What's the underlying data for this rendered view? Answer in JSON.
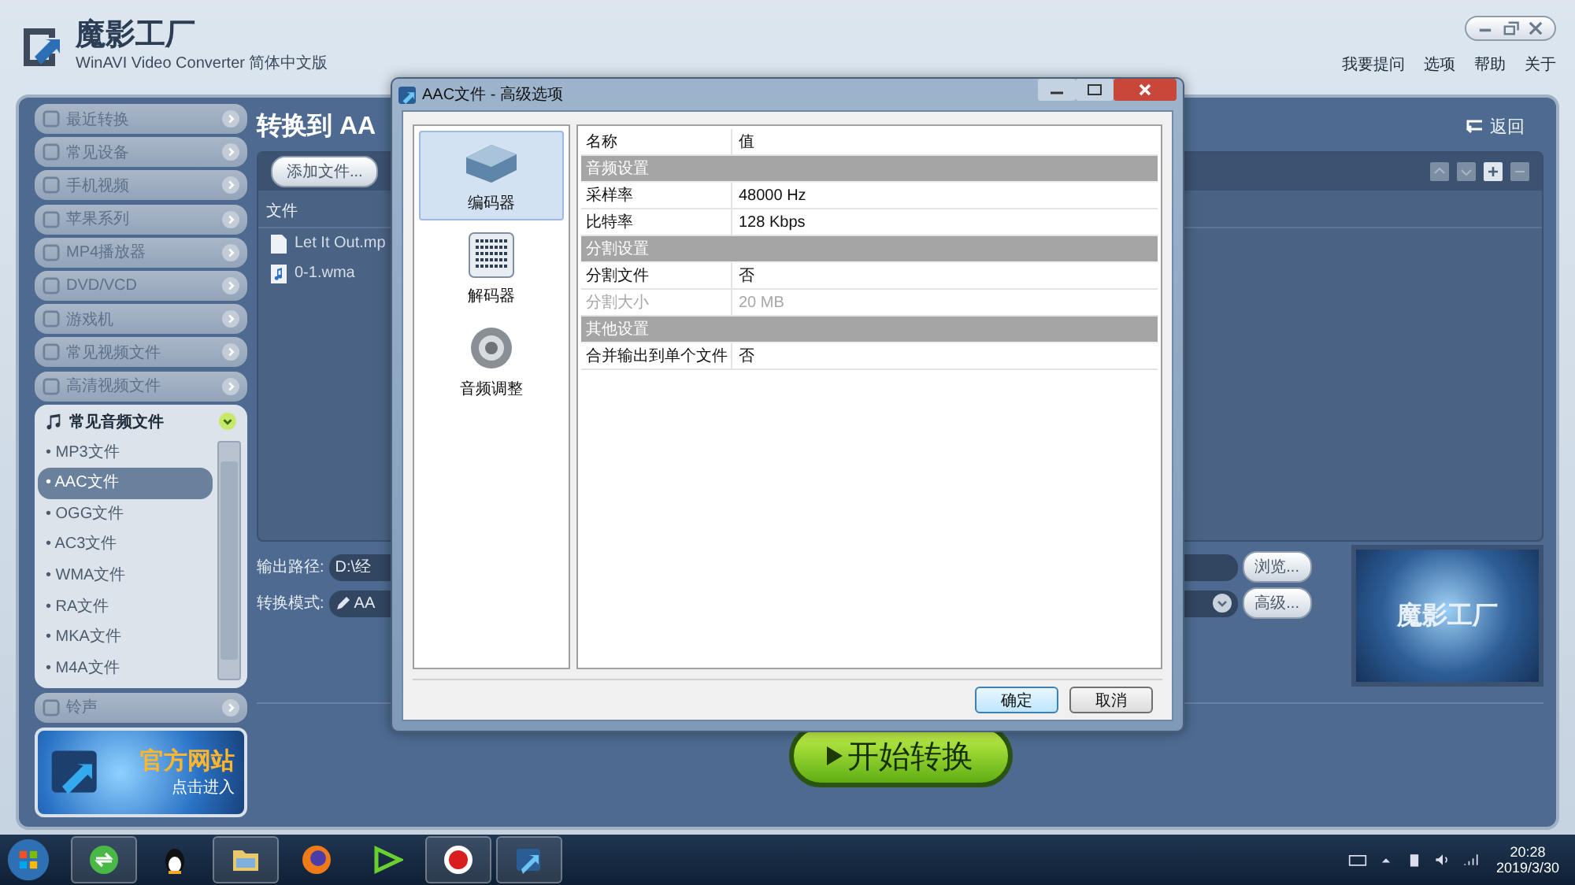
{
  "app": {
    "title": "魔影工厂",
    "subtitle": "WinAVI Video Converter 简体中文版",
    "menu": [
      "我要提问",
      "选项",
      "帮助",
      "关于"
    ]
  },
  "sidebar": {
    "categories": [
      {
        "label": "最近转换",
        "expanded": false
      },
      {
        "label": "常见设备",
        "expanded": false
      },
      {
        "label": "手机视频",
        "expanded": false
      },
      {
        "label": "苹果系列",
        "expanded": false
      },
      {
        "label": "MP4播放器",
        "expanded": false
      },
      {
        "label": "DVD/VCD",
        "expanded": false
      },
      {
        "label": "游戏机",
        "expanded": false
      },
      {
        "label": "常见视频文件",
        "expanded": false
      },
      {
        "label": "高清视频文件",
        "expanded": false
      },
      {
        "label": "常见音频文件",
        "expanded": true,
        "children": [
          {
            "label": "• MP3文件",
            "selected": false
          },
          {
            "label": "• AAC文件",
            "selected": true
          },
          {
            "label": "• OGG文件",
            "selected": false
          },
          {
            "label": "• AC3文件",
            "selected": false
          },
          {
            "label": "• WMA文件",
            "selected": false
          },
          {
            "label": "• RA文件",
            "selected": false
          },
          {
            "label": "• MKA文件",
            "selected": false
          },
          {
            "label": "• M4A文件",
            "selected": false
          }
        ]
      },
      {
        "label": "铃声",
        "expanded": false
      }
    ],
    "banner": {
      "title": "官方网站",
      "subtitle": "点击进入"
    }
  },
  "content": {
    "title": "转换到 AA",
    "back": "返回",
    "add_button": "添加文件...",
    "files_header": "文件",
    "files": [
      {
        "name": "Let It Out.mp",
        "kind": "document"
      },
      {
        "name": "0-1.wma",
        "kind": "audio"
      }
    ],
    "output_label": "输出路径:",
    "output_path": "D:\\经",
    "browse": "浏览...",
    "mode_label": "转换模式:",
    "mode_value": "AA",
    "advanced": "高级...",
    "preview_logo": "魔影工厂",
    "start": "开始转换"
  },
  "dialog": {
    "title": "AAC文件 - 高级选项",
    "nav": [
      {
        "label": "编码器",
        "kind": "encoder",
        "selected": true
      },
      {
        "label": "解码器",
        "kind": "decoder",
        "selected": false
      },
      {
        "label": "音频调整",
        "kind": "speaker",
        "selected": false
      }
    ],
    "columns": [
      "名称",
      "值"
    ],
    "rows": [
      {
        "kind": "group",
        "label": "音频设置"
      },
      {
        "kind": "prop",
        "name": "采样率",
        "value": "48000 Hz",
        "disabled": false
      },
      {
        "kind": "prop",
        "name": "比特率",
        "value": "128 Kbps",
        "disabled": false
      },
      {
        "kind": "group",
        "label": "分割设置"
      },
      {
        "kind": "prop",
        "name": "分割文件",
        "value": "否",
        "disabled": false
      },
      {
        "kind": "prop",
        "name": "分割大小",
        "value": "20 MB",
        "disabled": true
      },
      {
        "kind": "group",
        "label": "其他设置"
      },
      {
        "kind": "prop",
        "name": "合并输出到单个文件",
        "value": "否",
        "disabled": false
      }
    ],
    "buttons": [
      "确定",
      "取消"
    ]
  },
  "taskbar": {
    "apps": [
      {
        "kind": "refresh",
        "open": true
      },
      {
        "kind": "penguin",
        "open": false
      },
      {
        "kind": "folder",
        "open": true
      },
      {
        "kind": "globe",
        "open": false
      },
      {
        "kind": "play",
        "open": false
      },
      {
        "kind": "record",
        "open": true
      },
      {
        "kind": "converter",
        "open": true
      }
    ],
    "time": "20:28",
    "date": "2019/3/30"
  }
}
